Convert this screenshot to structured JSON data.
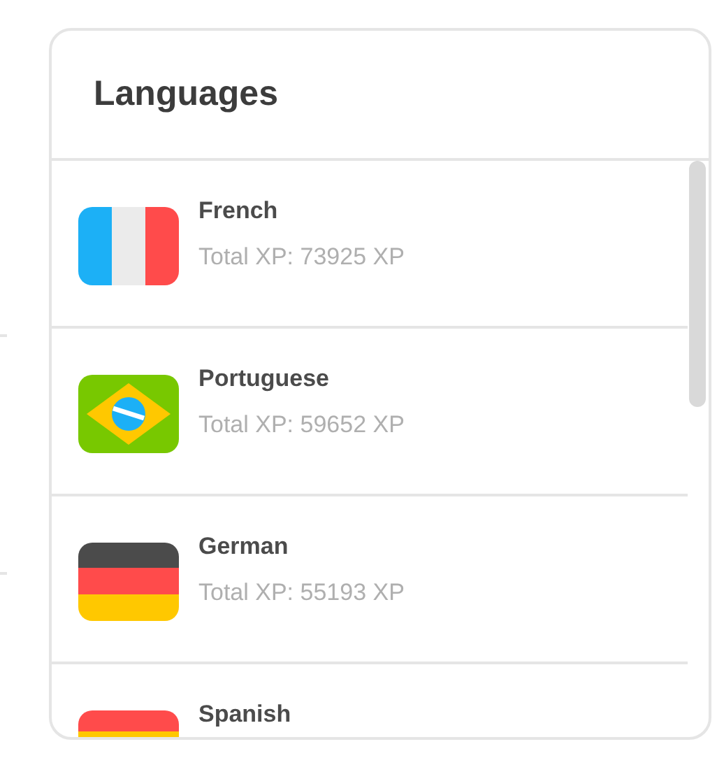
{
  "panel": {
    "title": "Languages"
  },
  "languages": [
    {
      "name": "French",
      "xp": "Total XP: 73925 XP",
      "kind": "fr"
    },
    {
      "name": "Portuguese",
      "xp": "Total XP: 59652 XP",
      "kind": "br"
    },
    {
      "name": "German",
      "xp": "Total XP: 55193 XP",
      "kind": "de"
    },
    {
      "name": "Spanish",
      "kind": "es"
    }
  ]
}
